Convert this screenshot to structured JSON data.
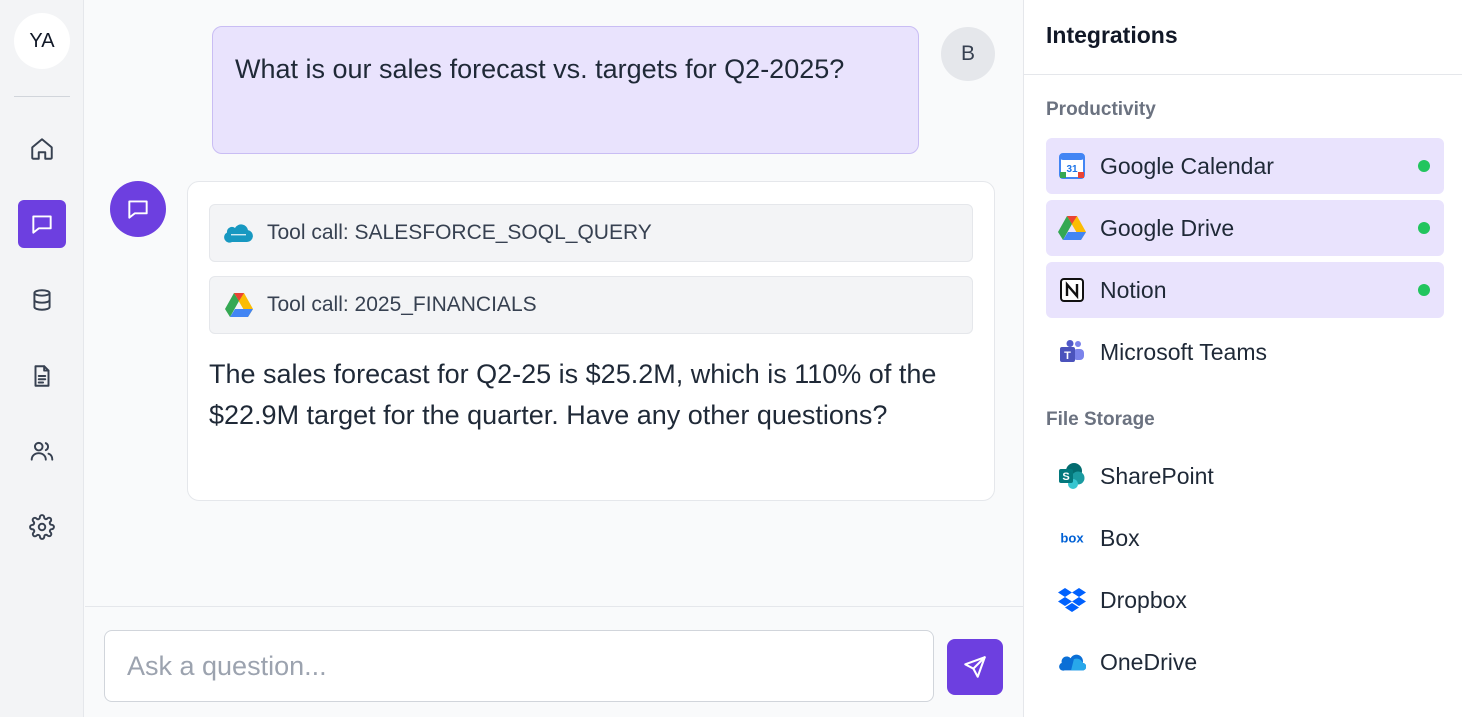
{
  "rail": {
    "avatar_initials": "YA",
    "items": [
      {
        "name": "home-icon",
        "active": false
      },
      {
        "name": "chat-icon",
        "active": true
      },
      {
        "name": "database-icon",
        "active": false
      },
      {
        "name": "document-icon",
        "active": false
      },
      {
        "name": "users-icon",
        "active": false
      },
      {
        "name": "gear-icon",
        "active": false
      }
    ]
  },
  "chat": {
    "user_message": "What is our sales forecast vs. targets for Q2-2025?",
    "user_initial": "B",
    "tool_calls": [
      {
        "label": "Tool call: SALESFORCE_SOQL_QUERY",
        "icon": "salesforce-icon"
      },
      {
        "label": "Tool call: 2025_FINANCIALS",
        "icon": "google-drive-icon"
      }
    ],
    "bot_message": "The sales forecast for Q2-25 is $25.2M, which is 110% of the $22.9M target for the quarter. Have any other questions?"
  },
  "input": {
    "placeholder": "Ask a question..."
  },
  "integrations": {
    "title": "Integrations",
    "sections": [
      {
        "title": "Productivity",
        "items": [
          {
            "label": "Google Calendar",
            "icon": "google-calendar-icon",
            "connected": true
          },
          {
            "label": "Google Drive",
            "icon": "google-drive-icon",
            "connected": true
          },
          {
            "label": "Notion",
            "icon": "notion-icon",
            "connected": true
          },
          {
            "label": "Microsoft Teams",
            "icon": "microsoft-teams-icon",
            "connected": false
          }
        ]
      },
      {
        "title": "File Storage",
        "items": [
          {
            "label": "SharePoint",
            "icon": "sharepoint-icon",
            "connected": false
          },
          {
            "label": "Box",
            "icon": "box-icon",
            "connected": false
          },
          {
            "label": "Dropbox",
            "icon": "dropbox-icon",
            "connected": false
          },
          {
            "label": "OneDrive",
            "icon": "onedrive-icon",
            "connected": false
          }
        ]
      }
    ]
  },
  "colors": {
    "accent": "#6d3fe0",
    "connected_bg": "#e9e3fd",
    "status_connected": "#22c55e"
  }
}
